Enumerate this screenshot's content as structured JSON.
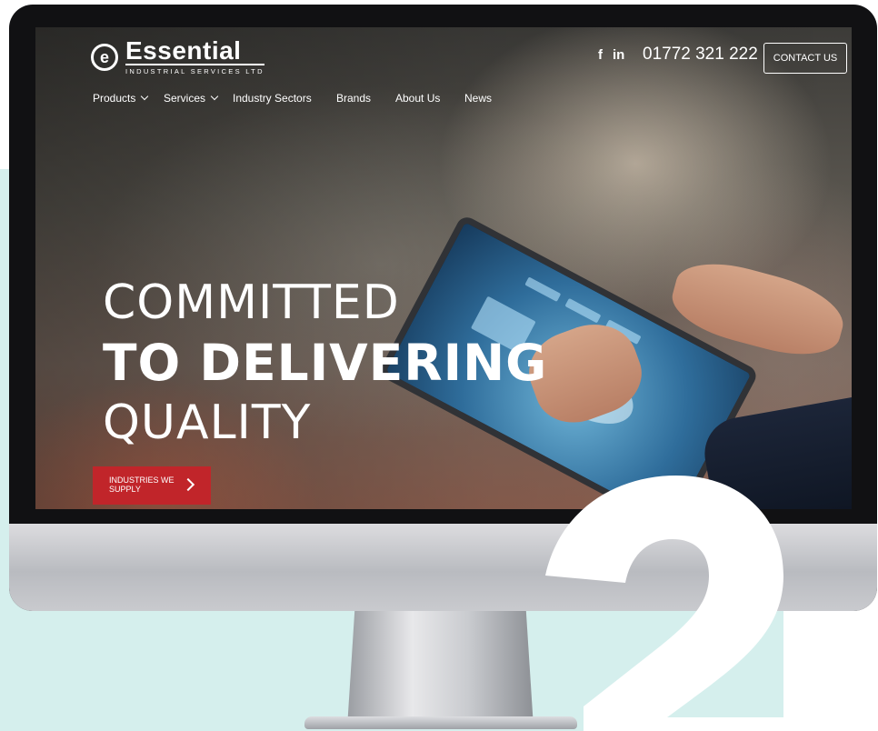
{
  "logo": {
    "glyph": "e",
    "name": "Essential",
    "tagline": "INDUSTRIAL SERVICES LTD"
  },
  "social": {
    "facebook": "f",
    "linkedin": "in"
  },
  "header": {
    "phone": "01772 321 222",
    "contact_label": "CONTACT US"
  },
  "nav": [
    {
      "label": "Products",
      "dropdown": true
    },
    {
      "label": "Services",
      "dropdown": true
    },
    {
      "label": "Industry Sectors",
      "dropdown": false
    },
    {
      "label": "Brands",
      "dropdown": false
    },
    {
      "label": "About Us",
      "dropdown": false
    },
    {
      "label": "News",
      "dropdown": false
    }
  ],
  "hero": {
    "line1": "COMMITTED",
    "line2": "TO DELIVERING",
    "line3": "QUALITY",
    "cta_label": "INDUSTRIES WE SUPPLY"
  },
  "step_numeral": "2",
  "colors": {
    "cta_red": "#c1252a",
    "background_mint": "#d5efed",
    "monitor_bezel": "#111113"
  }
}
